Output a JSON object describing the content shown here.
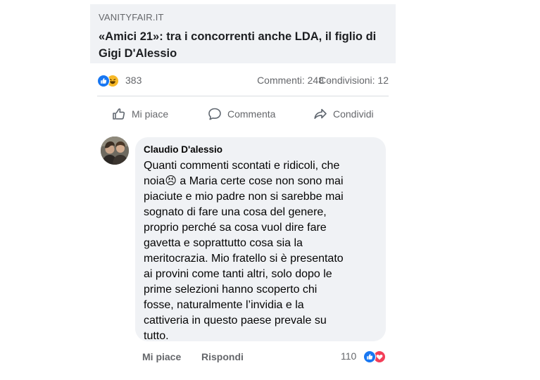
{
  "link": {
    "domain": "VANITYFAIR.IT",
    "title": "«Amici 21»: tra i concorrenti anche LDA, il figlio di Gigi D'Alessio"
  },
  "stats": {
    "reaction_icons": [
      "like-icon",
      "haha-icon"
    ],
    "reaction_count": "383",
    "comments": "Commenti: 248",
    "separator": "·",
    "shares": "Condivisioni: 12"
  },
  "actions": {
    "like_label": "Mi piace",
    "comment_label": "Commenta",
    "share_label": "Condividi"
  },
  "comment": {
    "author": "Claudio D'alessio",
    "text": "Quanti commenti scontati e ridicoli, che\nnoia😣 a Maria certe cose non sono mai\npiaciute e mio padre non si sarebbe mai\nsognato di fare una cosa del genere,\nproprio perché sa cosa vuol dire fare\ngavetta e soprattutto cosa sia la\nmeritocrazia. Mio fratello si è presentato\nai provini come tanti altri, solo dopo le\nprime selezioni hanno scoperto chi\nfosse, naturalmente l’invidia e la\ncattiveria in questo paese prevale su\ntutto.",
    "like_label": "Mi piace",
    "reply_label": "Rispondi",
    "reaction_count": "110",
    "reaction_icons": [
      "like-icon",
      "love-icon"
    ]
  },
  "colors": {
    "like_blue": "#1877f2",
    "haha_yellow": "#f7b928",
    "love_red": "#f33e58",
    "bubble_bg": "#f0f2f5",
    "muted_text": "#65676b"
  }
}
